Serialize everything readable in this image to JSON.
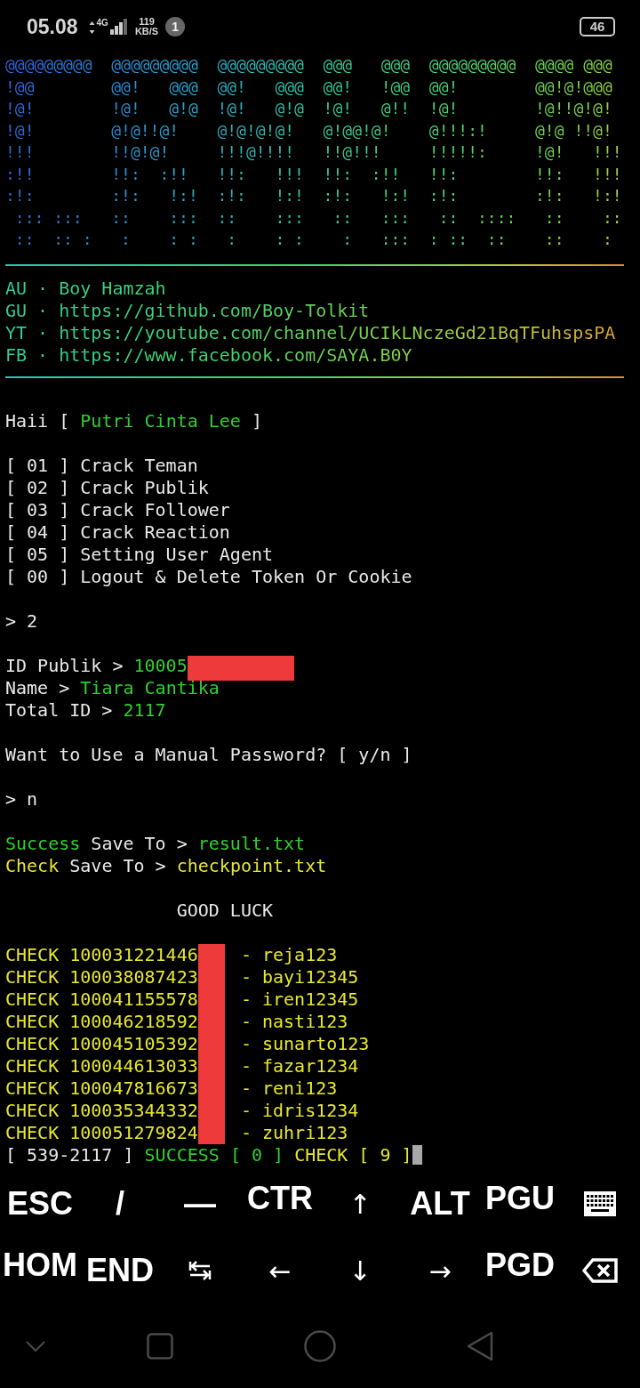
{
  "status_bar": {
    "time": "05.08",
    "network": "4G",
    "speed_value": "119",
    "speed_unit": "KB/S",
    "notification_count": "1",
    "battery": "46"
  },
  "banner": {
    "lines": [
      "@@@@@@@@@  @@@@@@@@@  @@@@@@@@@  @@@   @@@  @@@@@@@@@  @@@@ @@@",
      "!@@        @@!   @@@  @@!   @@@  @@!   !@@  @@!        @@!@!@@@",
      "!@!        !@!   @!@  !@!   @!@  !@!   @!!  !@!        !@!!@!@!",
      "!@!        @!@!!@!    @!@!@!@!   @!@@!@!    @!!!:!     @!@ !!@!",
      "!!!        !!@!@!     !!!@!!!!   !!@!!!     !!!!!:     !@!   !!!",
      ":!!        !!:  :!!   !!:   !!!  !!:  :!!   !!:        !!:   !!!",
      ":!:        :!:   !:!  :!:   !:!  :!:   !:!  :!:        :!:   !:!",
      " ::: :::   ::    :::  ::    :::   ::   :::   ::  ::::   ::    ::",
      " ::  :: :   :    : :   :    : :    :   :::  : ::  ::    ::    :"
    ]
  },
  "credits": [
    "AU · Boy Hamzah",
    "GU · https://github.com/Boy-Tolkit",
    "YT · https://youtube.com/channel/UCIkLNczeGd21BqTFuhspsPA",
    "FB · https://www.facebook.com/SAYA.B0Y"
  ],
  "blocks": [
    {
      "lines": [
        {
          "segments": [
            {
              "kind": "text",
              "text": "Haii [ ",
              "color": "#e8e8e8"
            },
            {
              "kind": "text",
              "text": "Putri Cinta Lee",
              "color": "#2fd02f"
            },
            {
              "kind": "text",
              "text": " ]",
              "color": "#e8e8e8"
            }
          ]
        }
      ]
    },
    {
      "lines": [
        {
          "segments": [
            {
              "kind": "text",
              "text": "[ 01 ] Crack Teman",
              "color": "#e8e8e8"
            }
          ]
        },
        {
          "segments": [
            {
              "kind": "text",
              "text": "[ 02 ] Crack Publik",
              "color": "#e8e8e8"
            }
          ]
        },
        {
          "segments": [
            {
              "kind": "text",
              "text": "[ 03 ] Crack Follower",
              "color": "#e8e8e8"
            }
          ]
        },
        {
          "segments": [
            {
              "kind": "text",
              "text": "[ 04 ] Crack Reaction",
              "color": "#e8e8e8"
            }
          ]
        },
        {
          "segments": [
            {
              "kind": "text",
              "text": "[ 05 ] Setting User Agent",
              "color": "#e8e8e8"
            }
          ]
        },
        {
          "segments": [
            {
              "kind": "text",
              "text": "[ 00 ] Logout & Delete Token Or Cookie",
              "color": "#e8e8e8"
            }
          ]
        }
      ]
    },
    {
      "lines": [
        {
          "segments": [
            {
              "kind": "text",
              "text": "> 2",
              "color": "#e8e8e8"
            }
          ]
        }
      ]
    },
    {
      "lines": [
        {
          "segments": [
            {
              "kind": "text",
              "text": "ID Publik > ",
              "color": "#e8e8e8"
            },
            {
              "kind": "text",
              "text": "10005",
              "color": "#2fd02f"
            },
            {
              "kind": "mask-long"
            }
          ]
        },
        {
          "segments": [
            {
              "kind": "text",
              "text": "Name > ",
              "color": "#e8e8e8"
            },
            {
              "kind": "text",
              "text": "Tiara Cantika",
              "color": "#2fd02f"
            }
          ]
        },
        {
          "segments": [
            {
              "kind": "text",
              "text": "Total ID > ",
              "color": "#e8e8e8"
            },
            {
              "kind": "text",
              "text": "2117",
              "color": "#2fd02f"
            }
          ]
        }
      ]
    },
    {
      "lines": [
        {
          "segments": [
            {
              "kind": "text",
              "text": "Want to Use a Manual Password? [ y/n ]",
              "color": "#e8e8e8"
            }
          ]
        }
      ]
    },
    {
      "lines": [
        {
          "segments": [
            {
              "kind": "text",
              "text": "> n",
              "color": "#e8e8e8"
            }
          ]
        }
      ]
    },
    {
      "lines": [
        {
          "segments": [
            {
              "kind": "text",
              "text": "Success",
              "color": "#2fd02f"
            },
            {
              "kind": "text",
              "text": " Save To > ",
              "color": "#e8e8e8"
            },
            {
              "kind": "text",
              "text": "result.txt",
              "color": "#2fd02f"
            }
          ]
        },
        {
          "segments": [
            {
              "kind": "text",
              "text": "Check",
              "color": "#e6e630"
            },
            {
              "kind": "text",
              "text": " Save To > ",
              "color": "#e8e8e8"
            },
            {
              "kind": "text",
              "text": "checkpoint.txt",
              "color": "#e6e630"
            }
          ]
        }
      ]
    },
    {
      "lines": [
        {
          "kind": "centered",
          "segments": [
            {
              "kind": "text",
              "text": "GOOD LUCK",
              "color": "#e8e8e8"
            }
          ]
        }
      ]
    },
    {
      "lines": [
        {
          "segments": [
            {
              "kind": "text",
              "text": "CHECK 100031221446",
              "color": "#e6e630"
            },
            {
              "kind": "mask-short"
            },
            {
              "kind": "text",
              "text": " - reja123",
              "color": "#e6e630"
            }
          ]
        },
        {
          "segments": [
            {
              "kind": "text",
              "text": "CHECK 100038087423",
              "color": "#e6e630"
            },
            {
              "kind": "mask-short"
            },
            {
              "kind": "text",
              "text": " - bayi12345",
              "color": "#e6e630"
            }
          ]
        },
        {
          "segments": [
            {
              "kind": "text",
              "text": "CHECK 100041155578",
              "color": "#e6e630"
            },
            {
              "kind": "mask-short"
            },
            {
              "kind": "text",
              "text": " - iren12345",
              "color": "#e6e630"
            }
          ]
        },
        {
          "segments": [
            {
              "kind": "text",
              "text": "CHECK 100046218592",
              "color": "#e6e630"
            },
            {
              "kind": "mask-short"
            },
            {
              "kind": "text",
              "text": " - nasti123",
              "color": "#e6e630"
            }
          ]
        },
        {
          "segments": [
            {
              "kind": "text",
              "text": "CHECK 100045105392",
              "color": "#e6e630"
            },
            {
              "kind": "mask-short"
            },
            {
              "kind": "text",
              "text": " - sunarto123",
              "color": "#e6e630"
            }
          ]
        },
        {
          "segments": [
            {
              "kind": "text",
              "text": "CHECK 100044613033",
              "color": "#e6e630"
            },
            {
              "kind": "mask-short"
            },
            {
              "kind": "text",
              "text": " - fazar1234",
              "color": "#e6e630"
            }
          ]
        },
        {
          "segments": [
            {
              "kind": "text",
              "text": "CHECK 100047816673",
              "color": "#e6e630"
            },
            {
              "kind": "mask-short"
            },
            {
              "kind": "text",
              "text": " - reni123",
              "color": "#e6e630"
            }
          ]
        },
        {
          "segments": [
            {
              "kind": "text",
              "text": "CHECK 100035344332",
              "color": "#e6e630"
            },
            {
              "kind": "mask-short"
            },
            {
              "kind": "text",
              "text": " - idris1234",
              "color": "#e6e630"
            }
          ]
        },
        {
          "segments": [
            {
              "kind": "text",
              "text": "CHECK 100051279824",
              "color": "#e6e630"
            },
            {
              "kind": "mask-short"
            },
            {
              "kind": "text",
              "text": " - zuhri123",
              "color": "#e6e630"
            }
          ]
        },
        {
          "kind": "prompt",
          "segments": [
            {
              "kind": "text",
              "text": "[ 539-2117 ] ",
              "color": "#e8e8e8"
            },
            {
              "kind": "text",
              "text": "SUCCESS [ 0 ] ",
              "color": "#2fd02f"
            },
            {
              "kind": "text",
              "text": "CHECK [ 9 ]",
              "color": "#e6e630"
            }
          ]
        }
      ]
    }
  ],
  "extra_keys": [
    {
      "kind": "label",
      "label": "ESC"
    },
    {
      "kind": "label",
      "label": "/"
    },
    {
      "kind": "label",
      "label": "—"
    },
    {
      "kind": "label-cut",
      "label": "CTR"
    },
    {
      "kind": "arrow",
      "label": "↑"
    },
    {
      "kind": "label",
      "label": "ALT"
    },
    {
      "kind": "label-cut",
      "label": "PGU"
    },
    {
      "kind": "keyboard"
    },
    {
      "kind": "label-cut",
      "label": "HOM"
    },
    {
      "kind": "label",
      "label": "END"
    },
    {
      "kind": "tab"
    },
    {
      "kind": "arrow",
      "label": "←"
    },
    {
      "kind": "arrow",
      "label": "↓"
    },
    {
      "kind": "arrow",
      "label": "→"
    },
    {
      "kind": "label-cut",
      "label": "PGD"
    },
    {
      "kind": "backspace"
    }
  ]
}
